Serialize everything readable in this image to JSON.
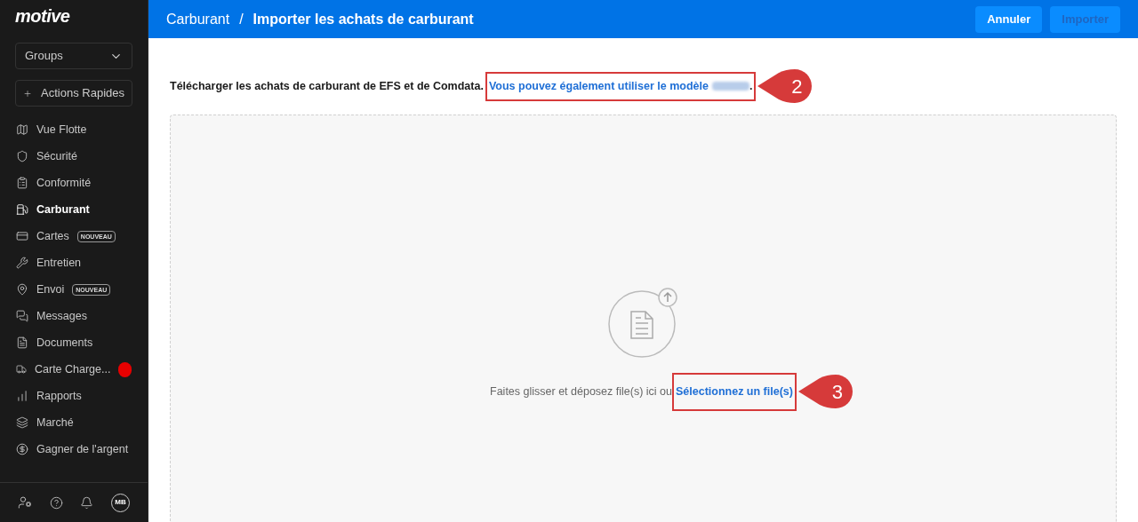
{
  "sidebar": {
    "logo": "motive",
    "groups_select": "Groups",
    "quick_actions": "Actions Rapides",
    "items": [
      {
        "label": "Vue Flotte",
        "selected": false
      },
      {
        "label": "Sécurité",
        "selected": false
      },
      {
        "label": "Conformité",
        "selected": false
      },
      {
        "label": "Carburant",
        "selected": true
      },
      {
        "label": "Cartes",
        "selected": false,
        "badge": "NOUVEAU"
      },
      {
        "label": "Entretien",
        "selected": false
      },
      {
        "label": "Envoi",
        "selected": false,
        "badge": "NOUVEAU"
      },
      {
        "label": "Messages",
        "selected": false
      },
      {
        "label": "Documents",
        "selected": false
      },
      {
        "label": "Carte Charge...",
        "selected": false,
        "color": "#e60000"
      },
      {
        "label": "Rapports",
        "selected": false
      },
      {
        "label": "Marché",
        "selected": false
      },
      {
        "label": "Gagner de l'argent",
        "selected": false
      }
    ],
    "avatar": "MB"
  },
  "header": {
    "breadcrumb": "Carburant",
    "separator": "/",
    "title": "Importer les achats de carburant",
    "buttons": [
      {
        "label": "Annuler",
        "disabled": false
      },
      {
        "label": "Importer",
        "disabled": true
      }
    ]
  },
  "intro": {
    "text": "Télécharger les achats de carburant de EFS et de Comdata.",
    "link": "Vous pouvez également utiliser le modèle",
    "end": ".",
    "callout": "2"
  },
  "dropzone": {
    "text": "Faites glisser et déposez file(s) ici ou",
    "link": "Sélectionnez un file(s)",
    "callout": "3"
  }
}
